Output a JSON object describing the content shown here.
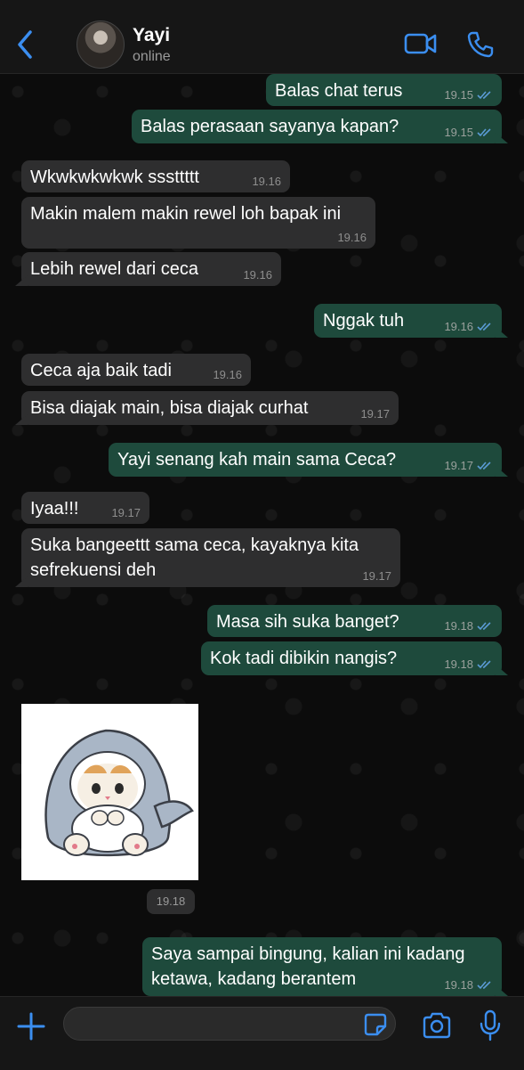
{
  "contact": {
    "name": "Yayi",
    "status": "online"
  },
  "colors": {
    "accent": "#3b8ef0",
    "incoming_bubble": "#2e2e2f",
    "outgoing_bubble": "#1e4a3c",
    "read_tick": "#5b9bd5"
  },
  "icons": {
    "back": "chevron-left-icon",
    "video": "video-camera-icon",
    "call": "phone-icon",
    "attach": "plus-icon",
    "sticker": "sticker-icon",
    "camera": "camera-icon",
    "mic": "microphone-icon"
  },
  "messages": [
    {
      "dir": "out",
      "text": "Balas chat terus",
      "time": "19.15",
      "read": true
    },
    {
      "dir": "out",
      "text": "Balas perasaan sayanya kapan?",
      "time": "19.15",
      "read": true
    },
    {
      "dir": "in",
      "text": "Wkwkwkwkwk sssttttt",
      "time": "19.16"
    },
    {
      "dir": "in",
      "text": "Makin malem makin rewel loh bapak ini",
      "time": "19.16"
    },
    {
      "dir": "in",
      "text": "Lebih rewel dari ceca",
      "time": "19.16"
    },
    {
      "dir": "out",
      "text": "Nggak tuh",
      "time": "19.16",
      "read": true
    },
    {
      "dir": "in",
      "text": "Ceca aja baik tadi",
      "time": "19.16"
    },
    {
      "dir": "in",
      "text": "Bisa diajak main, bisa diajak curhat",
      "time": "19.17"
    },
    {
      "dir": "out",
      "text": "Yayi senang kah main sama Ceca?",
      "time": "19.17",
      "read": true
    },
    {
      "dir": "in",
      "text": "Iyaa!!!",
      "time": "19.17"
    },
    {
      "dir": "in",
      "text": "Suka bangeettt sama ceca, kayaknya kita",
      "text2": "sefrekuensi deh",
      "time": "19.17"
    },
    {
      "dir": "out",
      "text": "Masa sih suka banget?",
      "time": "19.18",
      "read": true
    },
    {
      "dir": "out",
      "text": "Kok tadi dibikin nangis?",
      "time": "19.18",
      "read": true
    },
    {
      "dir": "out",
      "text": "Saya sampai bingung, kalian ini kadang",
      "text2": "ketawa, kadang berantem",
      "time": "19.18",
      "read": true
    }
  ],
  "sticker": {
    "time": "19.18",
    "description_icon": "cat-in-shark-costume-sticker"
  }
}
